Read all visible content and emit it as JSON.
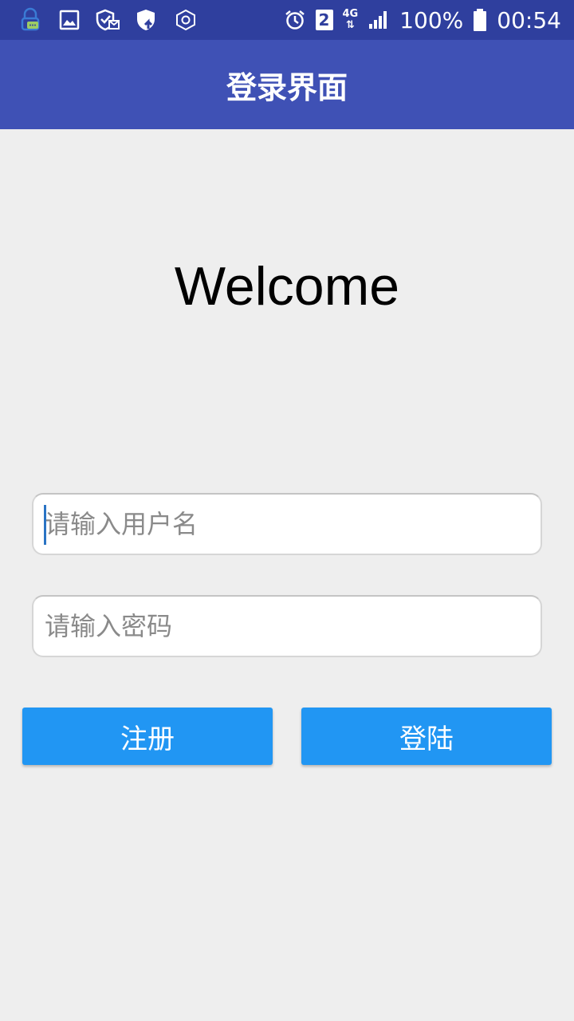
{
  "status_bar": {
    "left_icons": [
      "lock-chat-notification-icon",
      "image-notification-icon",
      "shield-check-notification-icon",
      "shield-upload-notification-icon",
      "hexagon-notification-icon"
    ],
    "sim_slot": "2",
    "network_type": "4G",
    "battery_percent": "100%",
    "time": "00:54"
  },
  "app_bar": {
    "title": "登录界面"
  },
  "main": {
    "welcome_text": "Welcome",
    "username_placeholder": "请输入用户名",
    "password_placeholder": "请输入密码",
    "register_label": "注册",
    "login_label": "登陆"
  },
  "colors": {
    "status_bar": "#2f3f9e",
    "app_bar": "#3f51b5",
    "button": "#2196f3",
    "background": "#eeeeee"
  }
}
